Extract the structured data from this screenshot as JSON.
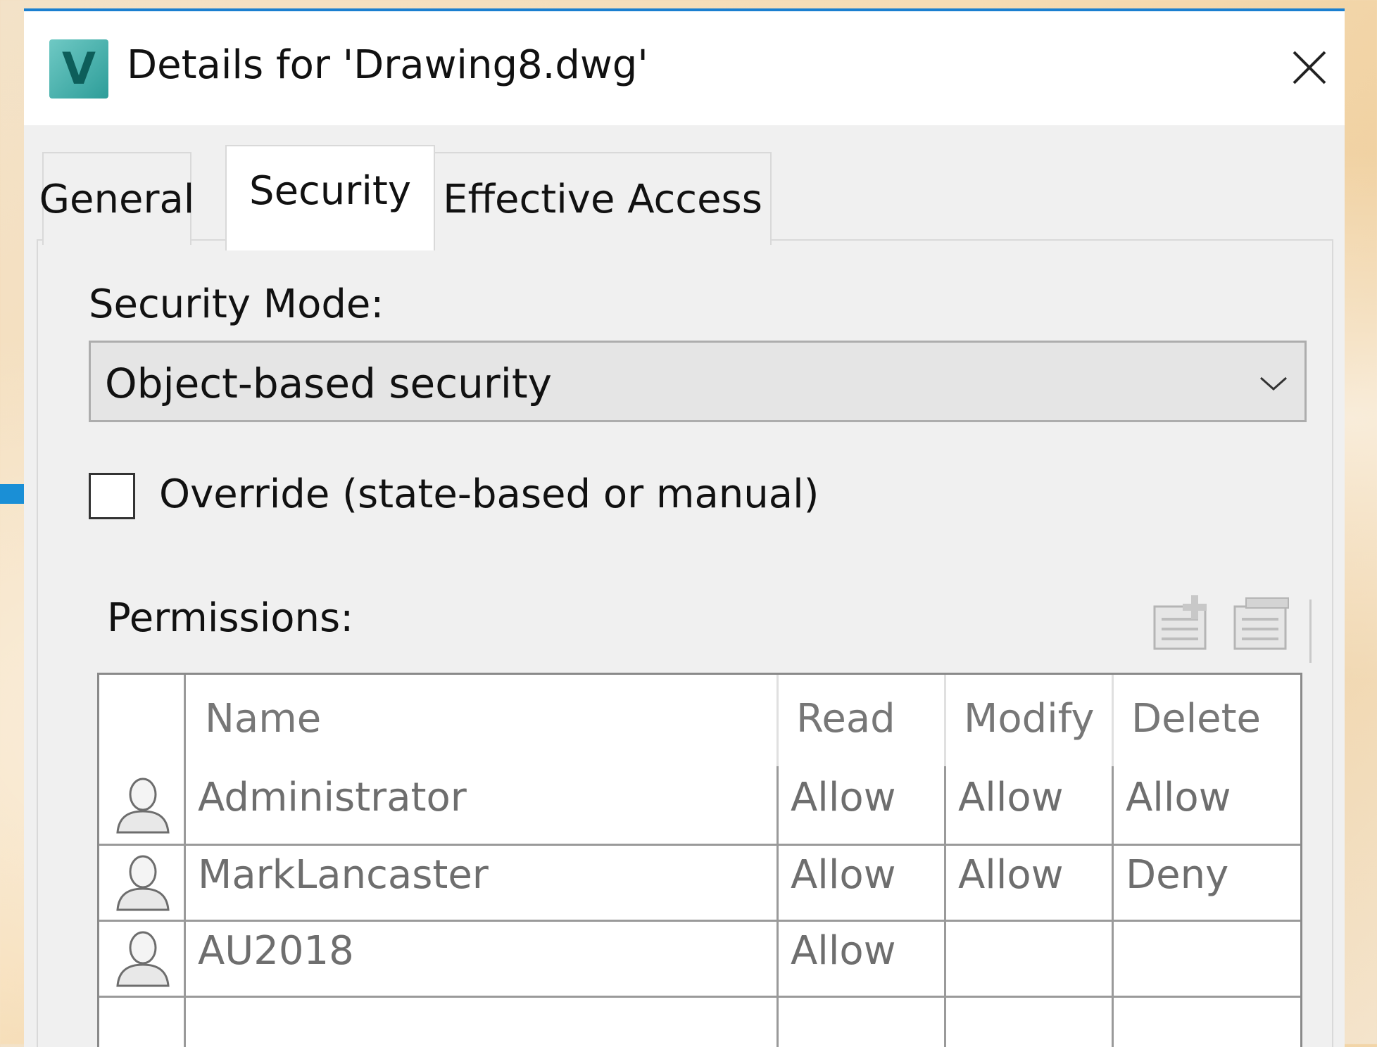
{
  "window": {
    "title": "Details for 'Drawing8.dwg'",
    "app_icon_letter": "V"
  },
  "tabs": [
    {
      "label": "General"
    },
    {
      "label": "Security",
      "active": true
    },
    {
      "label": "Effective Access"
    }
  ],
  "security": {
    "mode_label": "Security Mode:",
    "mode_value": "Object-based security",
    "override_label": "Override (state-based or manual)",
    "override_checked": false
  },
  "permissions": {
    "label": "Permissions:",
    "columns": [
      "Name",
      "Read",
      "Modify",
      "Delete"
    ],
    "rows": [
      {
        "name": "Administrator",
        "read": "Allow",
        "modify": "Allow",
        "delete": "Allow"
      },
      {
        "name": "MarkLancaster",
        "read": "Allow",
        "modify": "Allow",
        "delete": "Deny"
      },
      {
        "name": "AU2018",
        "read": "Allow",
        "modify": "",
        "delete": ""
      }
    ]
  },
  "colors": {
    "accent": "#1a7fd0",
    "arrow": "#1a8fd6"
  }
}
